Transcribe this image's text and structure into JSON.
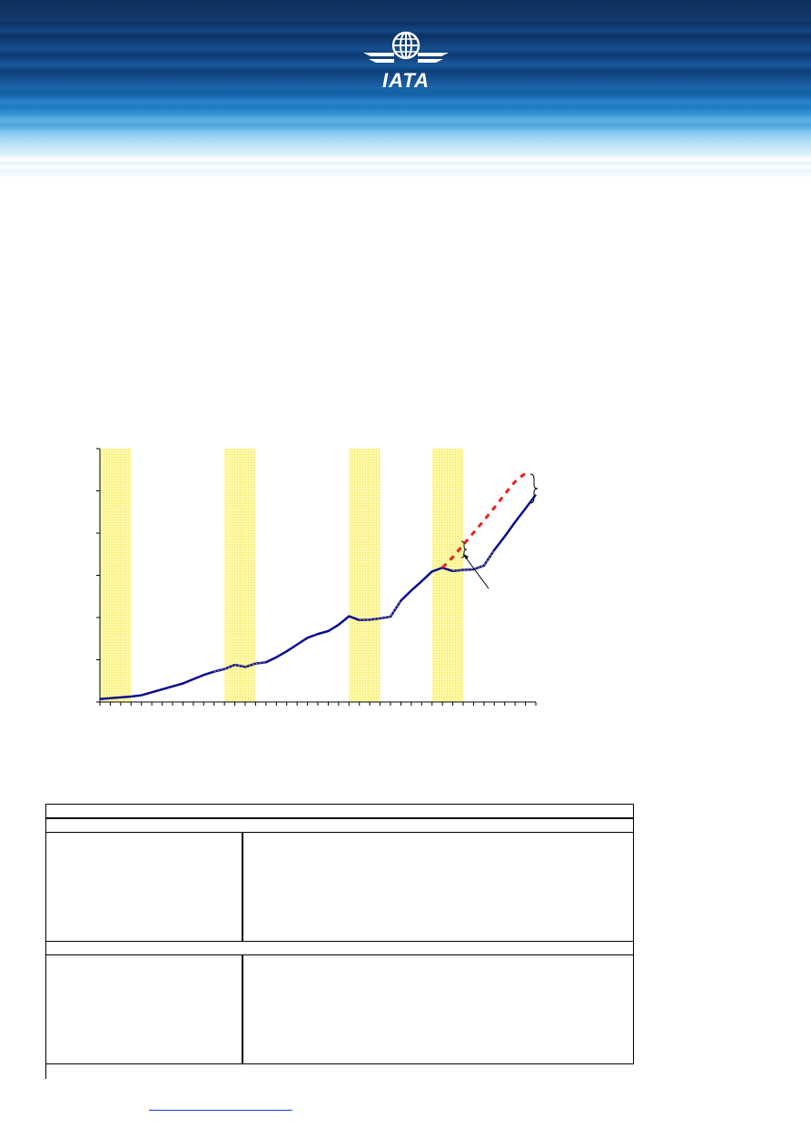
{
  "header": {
    "logo_text": "IATA",
    "colors": {
      "dark": "#0f2f5c",
      "mid": "#1c64a8",
      "light": "#86c8ee"
    }
  },
  "chart_data": {
    "type": "line",
    "title": "",
    "xlabel": "",
    "ylabel": "",
    "x_count": 42,
    "ylim": [
      0,
      6
    ],
    "yticks": [
      0,
      1,
      2,
      3,
      4,
      5,
      6
    ],
    "shaded_periods": [
      [
        0,
        3
      ],
      [
        12,
        15
      ],
      [
        24,
        27
      ],
      [
        32,
        35
      ]
    ],
    "series": [
      {
        "style": "solid-navy",
        "color": "#0a0a8c",
        "values": [
          0.07,
          0.09,
          0.11,
          0.13,
          0.16,
          0.23,
          0.3,
          0.37,
          0.44,
          0.54,
          0.64,
          0.72,
          0.78,
          0.88,
          0.83,
          0.91,
          0.94,
          1.06,
          1.2,
          1.36,
          1.52,
          1.61,
          1.68,
          1.83,
          2.03,
          1.94,
          1.95,
          1.98,
          2.02,
          2.4,
          2.64,
          2.86,
          3.09,
          3.18,
          3.1,
          3.13,
          3.14,
          3.23,
          3.6,
          3.92,
          4.26,
          4.58,
          4.91
        ]
      },
      {
        "style": "dashed-red",
        "color": "#e8201a",
        "start_index": 33,
        "values": [
          3.18,
          3.43,
          3.72,
          4.01,
          4.3,
          4.6,
          4.92,
          5.22,
          5.42
        ]
      }
    ],
    "grey_segments": [
      [
        11,
        16
      ],
      [
        25,
        29
      ],
      [
        34,
        38
      ]
    ]
  },
  "table": {
    "rows": []
  },
  "footer": {
    "link_text": ""
  }
}
